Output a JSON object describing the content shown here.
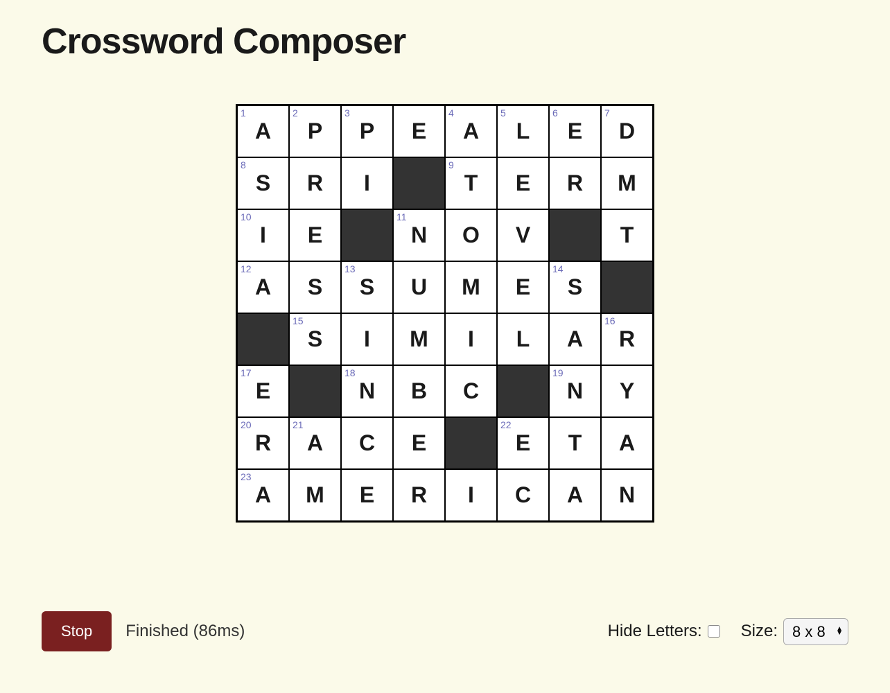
{
  "title": "Crossword Composer",
  "grid": {
    "size": 8,
    "cells": [
      [
        {
          "n": "1",
          "l": "A"
        },
        {
          "n": "2",
          "l": "P"
        },
        {
          "n": "3",
          "l": "P"
        },
        {
          "l": "E"
        },
        {
          "n": "4",
          "l": "A"
        },
        {
          "n": "5",
          "l": "L"
        },
        {
          "n": "6",
          "l": "E"
        },
        {
          "n": "7",
          "l": "D"
        }
      ],
      [
        {
          "n": "8",
          "l": "S"
        },
        {
          "l": "R"
        },
        {
          "l": "I"
        },
        {
          "black": true
        },
        {
          "n": "9",
          "l": "T"
        },
        {
          "l": "E"
        },
        {
          "l": "R"
        },
        {
          "l": "M"
        }
      ],
      [
        {
          "n": "10",
          "l": "I"
        },
        {
          "l": "E"
        },
        {
          "black": true
        },
        {
          "n": "11",
          "l": "N"
        },
        {
          "l": "O"
        },
        {
          "l": "V"
        },
        {
          "black": true
        },
        {
          "l": "T"
        }
      ],
      [
        {
          "n": "12",
          "l": "A"
        },
        {
          "l": "S"
        },
        {
          "n": "13",
          "l": "S"
        },
        {
          "l": "U"
        },
        {
          "l": "M"
        },
        {
          "l": "E"
        },
        {
          "n": "14",
          "l": "S"
        },
        {
          "black": true
        }
      ],
      [
        {
          "black": true
        },
        {
          "n": "15",
          "l": "S"
        },
        {
          "l": "I"
        },
        {
          "l": "M"
        },
        {
          "l": "I"
        },
        {
          "l": "L"
        },
        {
          "l": "A"
        },
        {
          "n": "16",
          "l": "R"
        }
      ],
      [
        {
          "n": "17",
          "l": "E"
        },
        {
          "black": true
        },
        {
          "n": "18",
          "l": "N"
        },
        {
          "l": "B"
        },
        {
          "l": "C"
        },
        {
          "black": true
        },
        {
          "n": "19",
          "l": "N"
        },
        {
          "l": "Y"
        }
      ],
      [
        {
          "n": "20",
          "l": "R"
        },
        {
          "n": "21",
          "l": "A"
        },
        {
          "l": "C"
        },
        {
          "l": "E"
        },
        {
          "black": true
        },
        {
          "n": "22",
          "l": "E"
        },
        {
          "l": "T"
        },
        {
          "l": "A"
        }
      ],
      [
        {
          "n": "23",
          "l": "A"
        },
        {
          "l": "M"
        },
        {
          "l": "E"
        },
        {
          "l": "R"
        },
        {
          "l": "I"
        },
        {
          "l": "C"
        },
        {
          "l": "A"
        },
        {
          "l": "N"
        }
      ]
    ]
  },
  "controls": {
    "stop_label": "Stop",
    "status": "Finished (86ms)",
    "hide_letters_label": "Hide Letters:",
    "hide_letters_checked": false,
    "size_label": "Size:",
    "size_value": "8 x 8"
  }
}
